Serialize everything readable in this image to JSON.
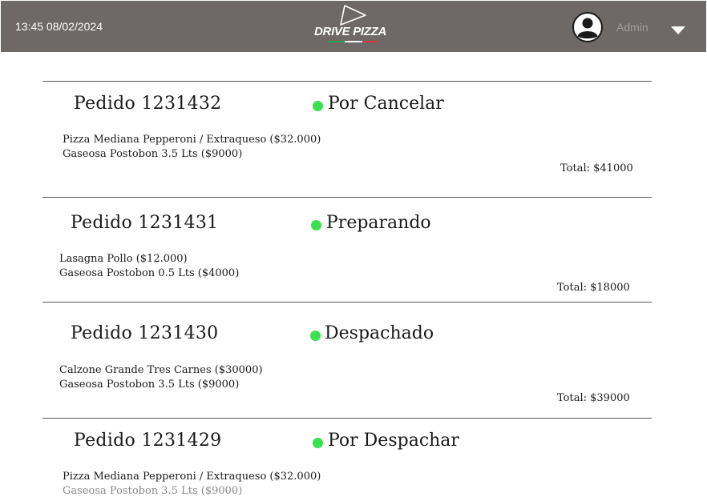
{
  "header": {
    "datetime": "13:45 08/02/2024",
    "logo_text": "DRIVE PIZZA",
    "user_label": "Admin",
    "colors": {
      "bar": "#6e6866",
      "logo_stripes": [
        "#2f9e44",
        "#ffffff",
        "#d63a3a"
      ]
    }
  },
  "orders": [
    {
      "title": "Pedido 1231432",
      "status": "Por Cancelar",
      "items": [
        "Pizza Mediana Pepperoni / Extraqueso ($32.000)",
        "Gaseosa Postobon 3.5 Lts ($9000)"
      ],
      "total": "Total: $41000"
    },
    {
      "title": "Pedido 1231431",
      "status": "Preparando",
      "items": [
        "Lasagna Pollo ($12.000)",
        "Gaseosa Postobon 0.5 Lts ($4000)"
      ],
      "total": "Total: $18000"
    },
    {
      "title": "Pedido 1231430",
      "status": "Despachado",
      "items": [
        "Calzone Grande Tres Carnes ($30000)",
        "Gaseosa Postobon 3.5 Lts ($9000)"
      ],
      "total": "Total: $39000"
    },
    {
      "title": "Pedido 1231429",
      "status": "Por Despachar",
      "items": [
        "Pizza Mediana Pepperoni / Extraqueso ($32.000)",
        "Gaseosa Postobon 3.5 Lts ($9000)"
      ]
    }
  ],
  "status_color": "#39e14f"
}
